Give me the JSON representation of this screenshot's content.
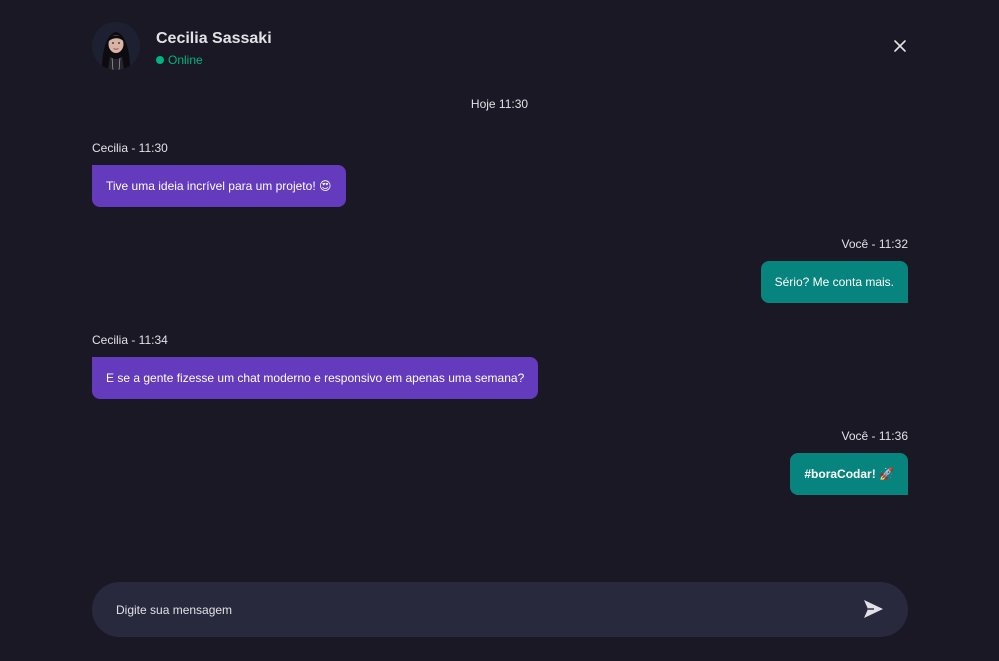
{
  "header": {
    "user_name": "Cecilia Sassaki",
    "status": "Online",
    "avatar_icon": "avatar-photo",
    "close_icon": "close-icon"
  },
  "conversation": {
    "day_label": "Hoje 11:30",
    "messages": [
      {
        "side": "left",
        "meta": "Cecilia - 11:30",
        "text": "Tive uma ideia incrível para um projeto! 😍"
      },
      {
        "side": "right",
        "meta": "Você - 11:32",
        "text": "Sério? Me conta mais."
      },
      {
        "side": "left",
        "meta": "Cecilia - 11:34",
        "text": "E se a gente fizesse um chat moderno e responsivo em apenas uma semana?"
      },
      {
        "side": "right",
        "meta": "Você - 11:36",
        "text": "#boraCodar! 🚀"
      }
    ]
  },
  "composer": {
    "placeholder": "Digite sua mensagem",
    "value": "",
    "send_icon": "send-icon"
  },
  "colors": {
    "background": "#1a1825",
    "incoming_bubble": "#633bbc",
    "outgoing_bubble": "#07847e",
    "online": "#00b37e",
    "input_background": "#29293e"
  }
}
